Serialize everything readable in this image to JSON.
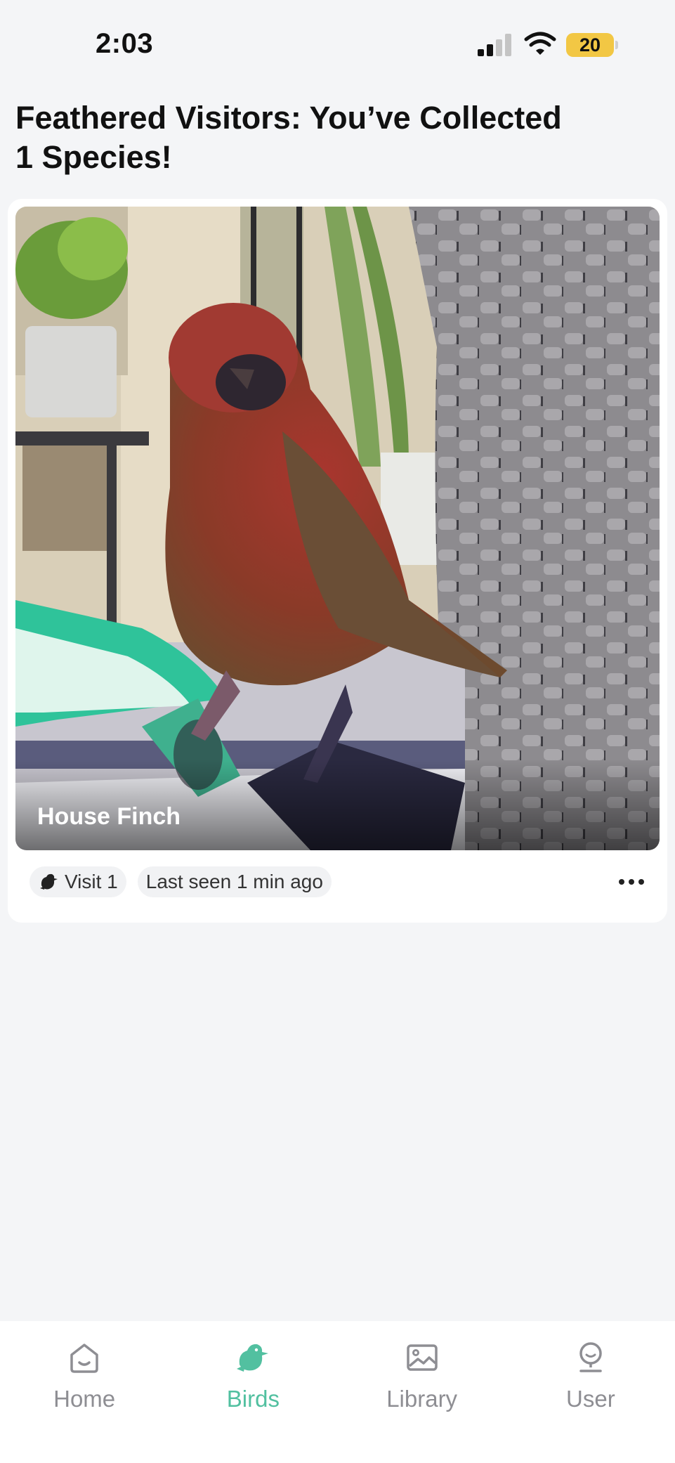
{
  "status_bar": {
    "time": "2:03",
    "battery": "20"
  },
  "page": {
    "title": "Feathered Visitors: You’ve Collected 1 Species!"
  },
  "species_card": {
    "bird_name": "House Finch",
    "visit_label": "Visit 1",
    "last_seen": "Last seen 1 min ago",
    "more_icon": "more-horizontal-icon"
  },
  "tab_bar": {
    "items": [
      {
        "label": "Home",
        "icon": "home-icon"
      },
      {
        "label": "Birds",
        "icon": "bird-icon",
        "active": true
      },
      {
        "label": "Library",
        "icon": "image-icon"
      },
      {
        "label": "User",
        "icon": "user-icon"
      }
    ]
  },
  "colors": {
    "accent": "#52c0a0",
    "battery": "#f2c744",
    "background": "#f4f5f7"
  }
}
